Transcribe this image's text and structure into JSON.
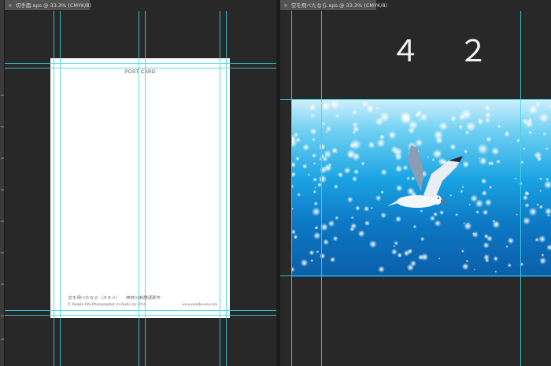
{
  "tabs": {
    "left": {
      "label": "切手面.eps @ 33.3% (CMYK/8)"
    },
    "right": {
      "label": "空を飛べたなら.eps @ 33.3% (CMYK/8)"
    }
  },
  "postcard": {
    "title": "POST CARD",
    "caption_title": "空を飛べたなら（カモメ）",
    "caption_place": "神奈川県横須賀市",
    "credit": "© Yumiko Ota Photographer, in Zushi city 2018",
    "website": "www.yumiko-ota.com"
  },
  "page_number": "４ ２",
  "photo": {
    "subject": "seagull-over-sparkling-sea"
  },
  "colors": {
    "guide": "#3fd4e0",
    "canvas": "#282828",
    "tab": "#535353"
  },
  "icons": {
    "close": "close-icon"
  }
}
